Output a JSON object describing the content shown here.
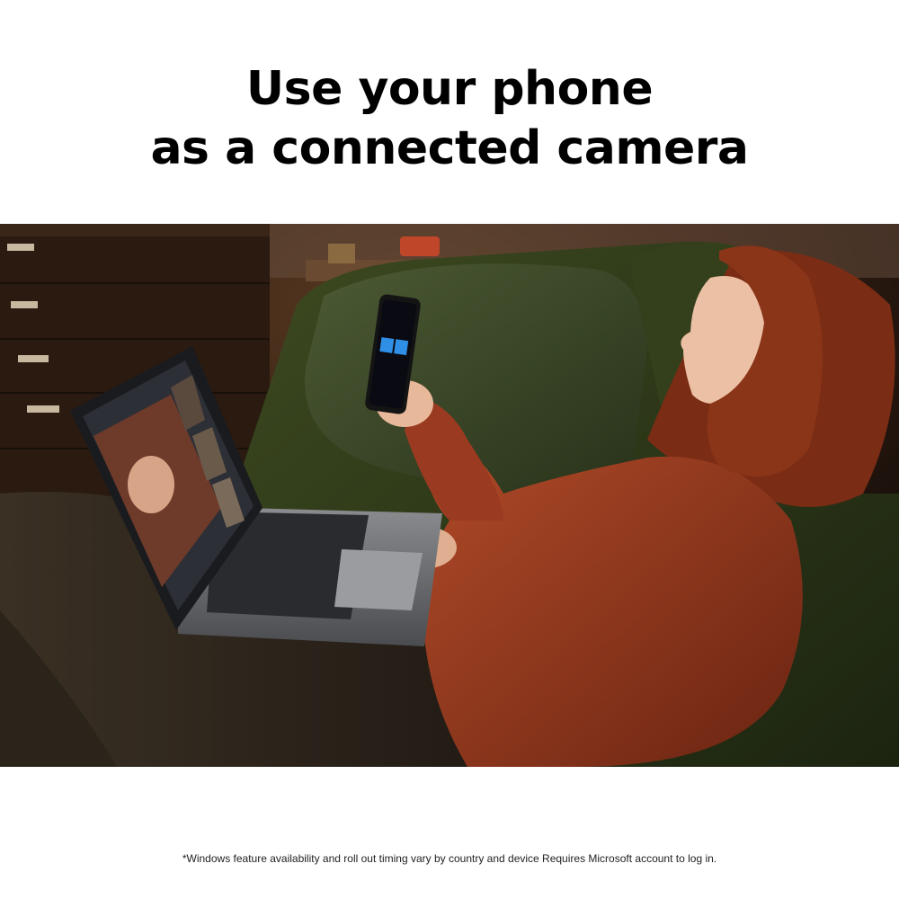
{
  "headline": {
    "line1": "Use your phone",
    "line2": "as a connected camera"
  },
  "disclaimer": "*Windows feature availability and roll out timing vary by country and device Requires Microsoft account to log in.",
  "colors": {
    "background": "#ffffff",
    "text": "#000000",
    "sofa": "#2e3a18",
    "sweater": "#9a3a20",
    "hair": "#8a3418",
    "phone_screen_accent": "#2f8fe6"
  }
}
